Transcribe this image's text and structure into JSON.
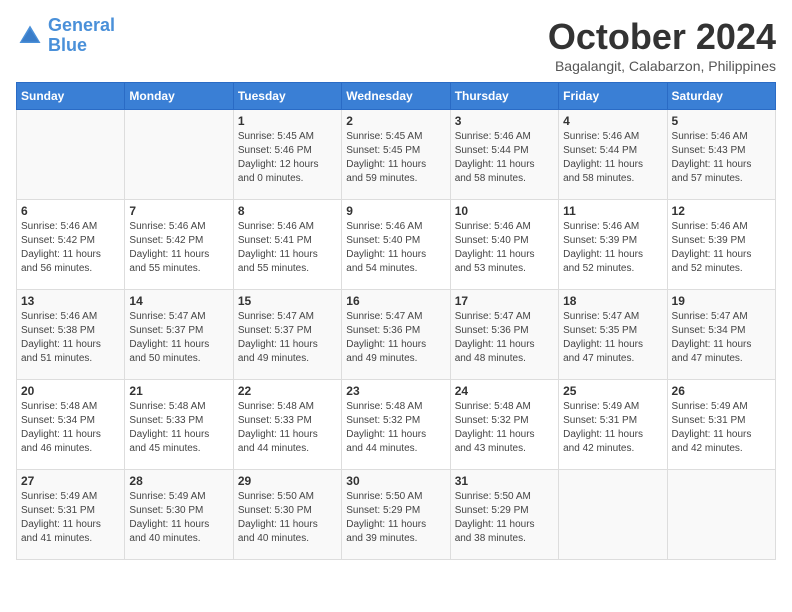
{
  "header": {
    "logo_line1": "General",
    "logo_line2": "Blue",
    "month_title": "October 2024",
    "location": "Bagalangit, Calabarzon, Philippines"
  },
  "columns": [
    "Sunday",
    "Monday",
    "Tuesday",
    "Wednesday",
    "Thursday",
    "Friday",
    "Saturday"
  ],
  "weeks": [
    [
      {
        "day": "",
        "info": ""
      },
      {
        "day": "",
        "info": ""
      },
      {
        "day": "1",
        "info": "Sunrise: 5:45 AM\nSunset: 5:46 PM\nDaylight: 12 hours\nand 0 minutes."
      },
      {
        "day": "2",
        "info": "Sunrise: 5:45 AM\nSunset: 5:45 PM\nDaylight: 11 hours\nand 59 minutes."
      },
      {
        "day": "3",
        "info": "Sunrise: 5:46 AM\nSunset: 5:44 PM\nDaylight: 11 hours\nand 58 minutes."
      },
      {
        "day": "4",
        "info": "Sunrise: 5:46 AM\nSunset: 5:44 PM\nDaylight: 11 hours\nand 58 minutes."
      },
      {
        "day": "5",
        "info": "Sunrise: 5:46 AM\nSunset: 5:43 PM\nDaylight: 11 hours\nand 57 minutes."
      }
    ],
    [
      {
        "day": "6",
        "info": "Sunrise: 5:46 AM\nSunset: 5:42 PM\nDaylight: 11 hours\nand 56 minutes."
      },
      {
        "day": "7",
        "info": "Sunrise: 5:46 AM\nSunset: 5:42 PM\nDaylight: 11 hours\nand 55 minutes."
      },
      {
        "day": "8",
        "info": "Sunrise: 5:46 AM\nSunset: 5:41 PM\nDaylight: 11 hours\nand 55 minutes."
      },
      {
        "day": "9",
        "info": "Sunrise: 5:46 AM\nSunset: 5:40 PM\nDaylight: 11 hours\nand 54 minutes."
      },
      {
        "day": "10",
        "info": "Sunrise: 5:46 AM\nSunset: 5:40 PM\nDaylight: 11 hours\nand 53 minutes."
      },
      {
        "day": "11",
        "info": "Sunrise: 5:46 AM\nSunset: 5:39 PM\nDaylight: 11 hours\nand 52 minutes."
      },
      {
        "day": "12",
        "info": "Sunrise: 5:46 AM\nSunset: 5:39 PM\nDaylight: 11 hours\nand 52 minutes."
      }
    ],
    [
      {
        "day": "13",
        "info": "Sunrise: 5:46 AM\nSunset: 5:38 PM\nDaylight: 11 hours\nand 51 minutes."
      },
      {
        "day": "14",
        "info": "Sunrise: 5:47 AM\nSunset: 5:37 PM\nDaylight: 11 hours\nand 50 minutes."
      },
      {
        "day": "15",
        "info": "Sunrise: 5:47 AM\nSunset: 5:37 PM\nDaylight: 11 hours\nand 49 minutes."
      },
      {
        "day": "16",
        "info": "Sunrise: 5:47 AM\nSunset: 5:36 PM\nDaylight: 11 hours\nand 49 minutes."
      },
      {
        "day": "17",
        "info": "Sunrise: 5:47 AM\nSunset: 5:36 PM\nDaylight: 11 hours\nand 48 minutes."
      },
      {
        "day": "18",
        "info": "Sunrise: 5:47 AM\nSunset: 5:35 PM\nDaylight: 11 hours\nand 47 minutes."
      },
      {
        "day": "19",
        "info": "Sunrise: 5:47 AM\nSunset: 5:34 PM\nDaylight: 11 hours\nand 47 minutes."
      }
    ],
    [
      {
        "day": "20",
        "info": "Sunrise: 5:48 AM\nSunset: 5:34 PM\nDaylight: 11 hours\nand 46 minutes."
      },
      {
        "day": "21",
        "info": "Sunrise: 5:48 AM\nSunset: 5:33 PM\nDaylight: 11 hours\nand 45 minutes."
      },
      {
        "day": "22",
        "info": "Sunrise: 5:48 AM\nSunset: 5:33 PM\nDaylight: 11 hours\nand 44 minutes."
      },
      {
        "day": "23",
        "info": "Sunrise: 5:48 AM\nSunset: 5:32 PM\nDaylight: 11 hours\nand 44 minutes."
      },
      {
        "day": "24",
        "info": "Sunrise: 5:48 AM\nSunset: 5:32 PM\nDaylight: 11 hours\nand 43 minutes."
      },
      {
        "day": "25",
        "info": "Sunrise: 5:49 AM\nSunset: 5:31 PM\nDaylight: 11 hours\nand 42 minutes."
      },
      {
        "day": "26",
        "info": "Sunrise: 5:49 AM\nSunset: 5:31 PM\nDaylight: 11 hours\nand 42 minutes."
      }
    ],
    [
      {
        "day": "27",
        "info": "Sunrise: 5:49 AM\nSunset: 5:31 PM\nDaylight: 11 hours\nand 41 minutes."
      },
      {
        "day": "28",
        "info": "Sunrise: 5:49 AM\nSunset: 5:30 PM\nDaylight: 11 hours\nand 40 minutes."
      },
      {
        "day": "29",
        "info": "Sunrise: 5:50 AM\nSunset: 5:30 PM\nDaylight: 11 hours\nand 40 minutes."
      },
      {
        "day": "30",
        "info": "Sunrise: 5:50 AM\nSunset: 5:29 PM\nDaylight: 11 hours\nand 39 minutes."
      },
      {
        "day": "31",
        "info": "Sunrise: 5:50 AM\nSunset: 5:29 PM\nDaylight: 11 hours\nand 38 minutes."
      },
      {
        "day": "",
        "info": ""
      },
      {
        "day": "",
        "info": ""
      }
    ]
  ]
}
